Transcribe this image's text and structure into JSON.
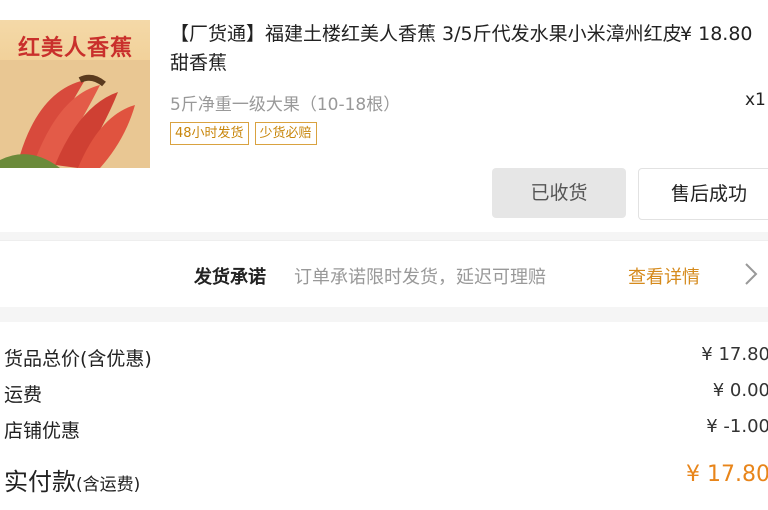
{
  "product": {
    "image_caption": "红美人香蕉",
    "title": "【厂货通】福建土楼红美人香蕉 3/5斤代发水果小米漳州红皮甜香蕉",
    "price": "¥ 18.80",
    "spec": "5斤净重一级大果（10-18根）",
    "quantity": "x1",
    "tags": [
      "48小时发货",
      "少货必赔"
    ],
    "buttons": {
      "received": "已收货",
      "after_sale": "售后成功"
    }
  },
  "promise": {
    "label": "发货承诺",
    "desc": "订单承诺限时发货，延迟可理赔",
    "link": "查看详情"
  },
  "summary": {
    "rows": [
      {
        "key": "货品总价(含优惠)",
        "value": "¥ 17.80"
      },
      {
        "key": "运费",
        "value": "¥ 0.00"
      },
      {
        "key": "店铺优惠",
        "value": "¥ -1.00"
      }
    ],
    "total_key": "实付款",
    "total_key_suffix": "(含运费)",
    "total_value": "¥ 17.80"
  },
  "colors": {
    "accent": "#e8851a",
    "tag": "#c8860b",
    "image_title": "#c9302c"
  }
}
